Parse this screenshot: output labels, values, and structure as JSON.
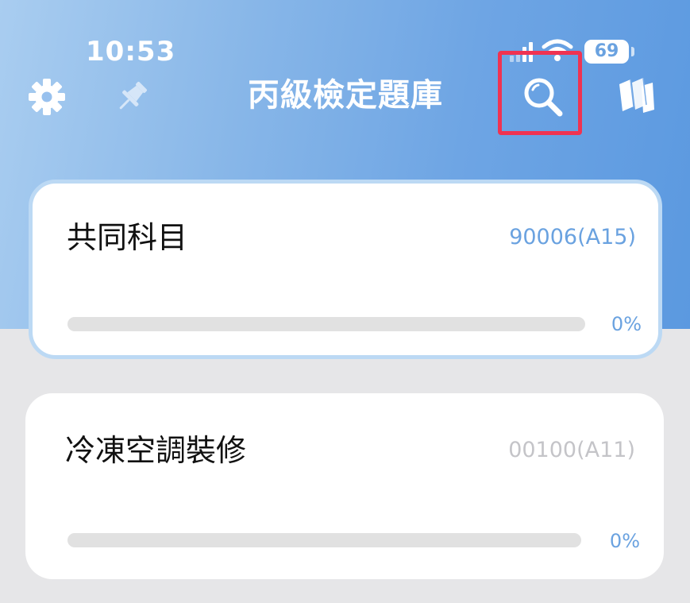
{
  "status_bar": {
    "time": "10:53",
    "battery": "69"
  },
  "header": {
    "title": "丙級檢定題庫"
  },
  "icons": {
    "settings": "gear-icon",
    "pin": "pin-icon",
    "search": "search-icon",
    "library": "books-icon"
  },
  "colors": {
    "header_gradient_start": "#a9cdf0",
    "header_gradient_end": "#5b99e0",
    "accent_blue": "#6aa2e0",
    "highlight_red": "#ef3352",
    "code_gray": "#c4c4c8"
  },
  "subjects": [
    {
      "title": "共同科目",
      "code": "90006(A15)",
      "progress_label": "0%",
      "progress": 0
    },
    {
      "title": "冷凍空調裝修",
      "code": "00100(A11)",
      "progress_label": "0%",
      "progress": 0
    }
  ]
}
